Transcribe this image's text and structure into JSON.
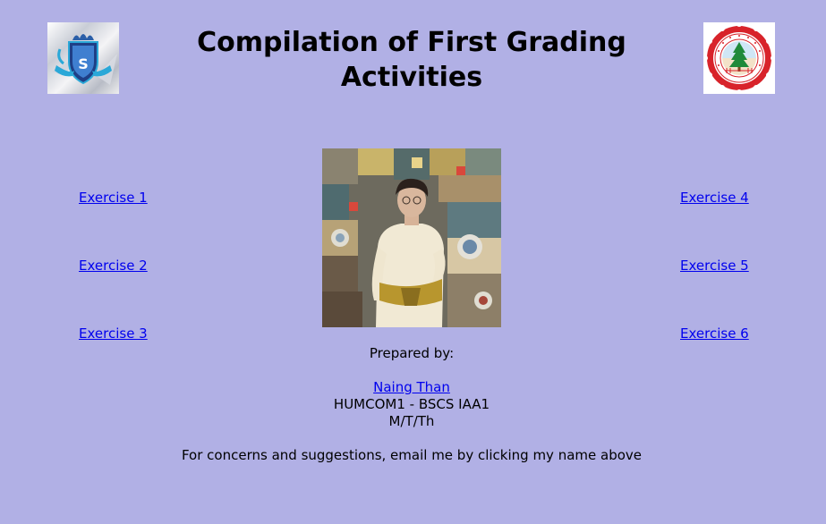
{
  "header": {
    "title": "Compilation of First Grading Activities"
  },
  "exercises": {
    "left": [
      "Exercise 1",
      "Exercise 2",
      "Exercise 3"
    ],
    "right": [
      "Exercise 4",
      "Exercise 5",
      "Exercise 6"
    ]
  },
  "author": {
    "prepared_label": "Prepared by:",
    "name": "Naing Than",
    "course": "HUMCOM1 - BSCS IAA1",
    "schedule": "M/T/Th"
  },
  "footer": {
    "concerns": "For concerns and suggestions, email me by clicking my name above"
  },
  "colors": {
    "background": "#b1b0e5",
    "link": "#0000ee"
  },
  "icons": {
    "left_logo": "shield-emblem-logo",
    "right_logo": "university-seal-logo"
  }
}
